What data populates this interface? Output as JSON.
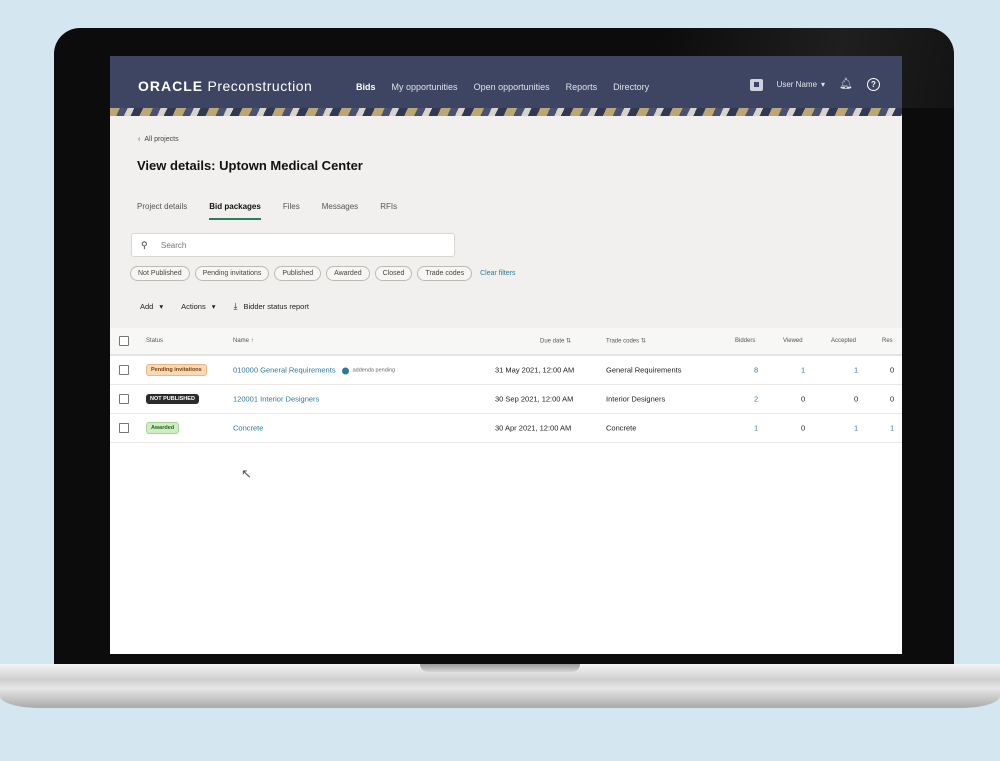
{
  "app": {
    "brand": "ORACLE",
    "product": "Preconstruction"
  },
  "nav": [
    "Bids",
    "My opportunities",
    "Open opportunities",
    "Reports",
    "Directory"
  ],
  "header": {
    "user": "User Name"
  },
  "breadcrumb": {
    "label": "All projects"
  },
  "page": {
    "title": "View details: Uptown Medical Center"
  },
  "tabs": [
    "Project details",
    "Bid packages",
    "Files",
    "Messages",
    "RFIs"
  ],
  "search": {
    "placeholder": "Search"
  },
  "filters": [
    "Not Published",
    "Pending invitations",
    "Published",
    "Awarded",
    "Closed",
    "Trade codes"
  ],
  "clear_filters": "Clear filters",
  "actions": {
    "add": "Add",
    "actions": "Actions",
    "report": "Bidder status report"
  },
  "table": {
    "headers": {
      "status": "Status",
      "name": "Name",
      "due": "Due date",
      "trade": "Trade codes",
      "bidders": "Bidders",
      "viewed": "Viewed",
      "accepted": "Accepted",
      "extra": "Res"
    },
    "rows": [
      {
        "status": "Pending invitations",
        "name": "010000 General Requirements",
        "note": "addenda pending",
        "due": "31 May 2021, 12:00 AM",
        "trade": "General Requirements",
        "bidders": "8",
        "viewed": "1",
        "accepted": "1",
        "extra": "0"
      },
      {
        "status": "NOT PUBLISHED",
        "name": "120001 Interior Designers",
        "note": "",
        "due": "30 Sep 2021, 12:00 AM",
        "trade": "Interior Designers",
        "bidders": "2",
        "viewed": "0",
        "accepted": "0",
        "extra": "0"
      },
      {
        "status": "Awarded",
        "name": "Concrete",
        "note": "",
        "due": "30 Apr 2021, 12:00 AM",
        "trade": "Concrete",
        "bidders": "1",
        "viewed": "0",
        "accepted": "1",
        "extra": "1"
      }
    ]
  }
}
